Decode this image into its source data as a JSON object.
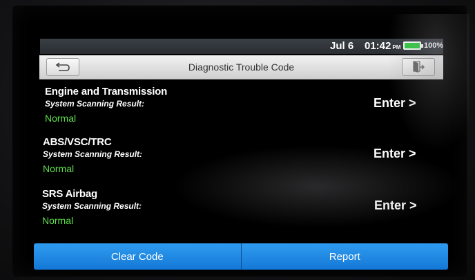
{
  "statusbar": {
    "date": "Jul 6",
    "time": "01:42",
    "ampm": "PM",
    "battery": "100%"
  },
  "titlebar": {
    "title": "Diagnostic Trouble Code",
    "back_icon": "back-arrow-icon",
    "exit_icon": "exit-icon"
  },
  "systems": [
    {
      "name": "Engine and Transmission",
      "result_label": "System Scanning Result:",
      "status": "Normal",
      "action": "Enter >"
    },
    {
      "name": "ABS/VSC/TRC",
      "result_label": "System Scanning Result:",
      "status": "Normal",
      "action": "Enter >"
    },
    {
      "name": "SRS Airbag",
      "result_label": "System Scanning Result:",
      "status": "Normal",
      "action": "Enter >"
    }
  ],
  "bottom": {
    "clear_code": "Clear Code",
    "report": "Report"
  },
  "colors": {
    "status_normal": "#5ee04a",
    "button_blue": "#1e8ae6",
    "battery_green": "#2ecc40"
  }
}
